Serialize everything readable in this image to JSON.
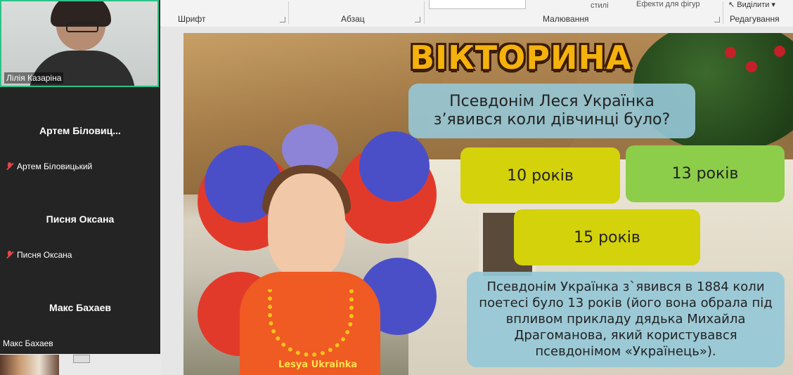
{
  "ribbon": {
    "font_group": "Шрифт",
    "paragraph_group": "Абзац",
    "drawing_group": "Малювання",
    "editing_group": "Редагування",
    "styles_label": "стилі",
    "effects_label": "Ефекти для фігур",
    "select_label": "Виділити"
  },
  "slide": {
    "title": "ВІКТОРИНА",
    "question": "Псевдонім Леся Українка з’явився коли дівчинці було?",
    "answers": [
      "10 років",
      "13 років",
      "15 років"
    ],
    "explanation": "Псевдонім Українка з`явився в 1884 коли поетесі було 13 років (його вона обрала під впливом прикладу дядька Михайла Драгоманова, який користувався псевдонімом «Українець»).",
    "poster_caption": "Lesya Ukrainka"
  },
  "video": {
    "self_name": "Лілія Казаріна",
    "participants": [
      {
        "display": "Артем Біловиц...",
        "label": "Артем Біловицький"
      },
      {
        "display": "Писня Оксана",
        "label": "Писня Оксана"
      },
      {
        "display": "Макс Бахаев",
        "label": "Макс Бахаев"
      }
    ]
  },
  "colors": {
    "answer_yellow": "#d4d20a",
    "answer_green": "#8ccd4a",
    "question_bg": "#96c8d7",
    "title_orange": "#f5b20c",
    "active_speaker_border": "#2cc28a"
  }
}
